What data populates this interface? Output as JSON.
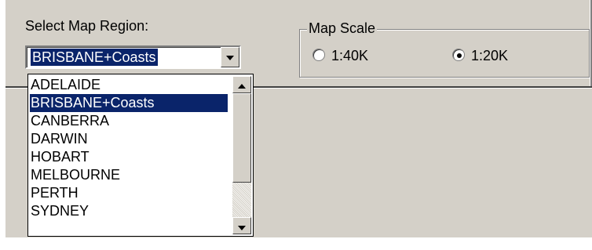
{
  "region": {
    "label": "Select Map Region:",
    "selected": "BRISBANE+Coasts",
    "options": [
      "ADELAIDE",
      "BRISBANE+Coasts",
      "CANBERRA",
      "DARWIN",
      "HOBART",
      "MELBOURNE",
      "PERTH",
      "SYDNEY"
    ],
    "selected_index": 1
  },
  "scale": {
    "title": "Map Scale",
    "options": [
      {
        "label": "1:40K",
        "checked": false
      },
      {
        "label": "1:20K",
        "checked": true
      }
    ]
  },
  "colors": {
    "highlight": "#0a246a",
    "face": "#d4d0c8"
  },
  "icons": {
    "combo_button": "chevron-down-icon",
    "scroll_up": "chevron-up-icon",
    "scroll_down": "chevron-down-icon",
    "radio": "radio-button-icon"
  }
}
